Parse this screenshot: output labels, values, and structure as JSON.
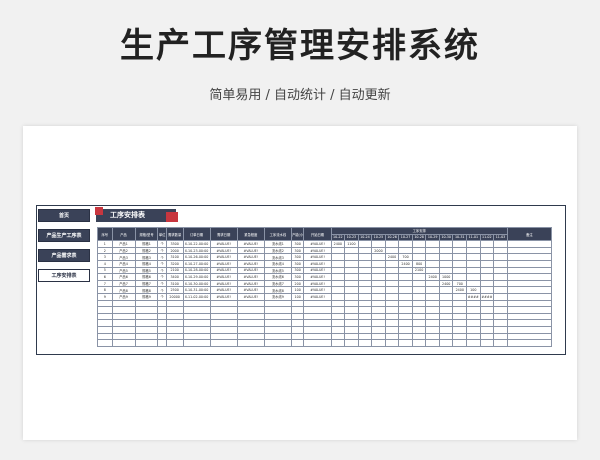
{
  "banner": {
    "title": "生产工序管理安排系统",
    "subtitle": "简单易用 / 自动统计 / 自动更新"
  },
  "sidebar": {
    "items": [
      {
        "label": "首页"
      },
      {
        "label": "产品生产工序表"
      },
      {
        "label": "产品需求表"
      },
      {
        "label": "工序安排表"
      }
    ]
  },
  "page": {
    "title": "工序安排表"
  },
  "table": {
    "headers": [
      "序号",
      "产品",
      "规格/型号",
      "单位",
      "需求数量",
      "订单日期",
      "需求日期",
      "紧急程度",
      "工序流水线",
      "产能(小时)",
      "开始日期"
    ],
    "gantt_header": "工序安排",
    "dates": [
      "10-22",
      "10-23",
      "10-24",
      "10-25",
      "10-26",
      "10-27",
      "10-28",
      "10-29",
      "10-30",
      "10-31",
      "11-01",
      "11-02",
      "11-03"
    ],
    "last_header": "备注",
    "rows": [
      {
        "no": "1",
        "product": "产品1",
        "spec": "规格1",
        "unit": "个",
        "qty": "3300",
        "order": "X-10-22-00:00",
        "need": "#VALUE!",
        "urgency": "#VALUE!",
        "line": "流水线1",
        "cap": "300",
        "start": "#VALUE!",
        "gantt": [
          "2400",
          "1100",
          "",
          "",
          "",
          "",
          "",
          "",
          "",
          "",
          "",
          "",
          ""
        ]
      },
      {
        "no": "2",
        "product": "产品2",
        "spec": "规格2",
        "unit": "个",
        "qty": "2000",
        "order": "X-10-23-00:00",
        "need": "#VALUE!",
        "urgency": "#VALUE!",
        "line": "流水线2",
        "cap": "300",
        "start": "#VALUE!",
        "gantt": [
          "",
          "",
          "",
          "2000",
          "",
          "",
          "",
          "",
          "",
          "",
          "",
          "",
          ""
        ]
      },
      {
        "no": "3",
        "product": "产品3",
        "spec": "规格3",
        "unit": "个",
        "qty": "3100",
        "order": "X-10-26-00:00",
        "need": "#VALUE!",
        "urgency": "#VALUE!",
        "line": "流水线3",
        "cap": "300",
        "start": "#VALUE!",
        "gantt": [
          "",
          "",
          "",
          "",
          "2400",
          "700",
          "",
          "",
          "",
          "",
          "",
          "",
          ""
        ]
      },
      {
        "no": "4",
        "product": "产品4",
        "spec": "规格4",
        "unit": "个",
        "qty": "3200",
        "order": "X-10-27-00:00",
        "need": "#VALUE!",
        "urgency": "#VALUE!",
        "line": "流水线4",
        "cap": "300",
        "start": "#VALUE!",
        "gantt": [
          "",
          "",
          "",
          "",
          "",
          "2400",
          "800",
          "",
          "",
          "",
          "",
          "",
          ""
        ]
      },
      {
        "no": "5",
        "product": "产品5",
        "spec": "规格5",
        "unit": "个",
        "qty": "2100",
        "order": "X-10-28-00:00",
        "need": "#VALUE!",
        "urgency": "#VALUE!",
        "line": "流水线5",
        "cap": "300",
        "start": "#VALUE!",
        "gantt": [
          "",
          "",
          "",
          "",
          "",
          "",
          "2100",
          "",
          "",
          "",
          "",
          "",
          ""
        ]
      },
      {
        "no": "6",
        "product": "产品6",
        "spec": "规格6",
        "unit": "个",
        "qty": "3400",
        "order": "X-10-29-00:00",
        "need": "#VALUE!",
        "urgency": "#VALUE!",
        "line": "流水线6",
        "cap": "300",
        "start": "#VALUE!",
        "gantt": [
          "",
          "",
          "",
          "",
          "",
          "",
          "",
          "2400",
          "1000",
          "",
          "",
          "",
          ""
        ]
      },
      {
        "no": "7",
        "product": "产品7",
        "spec": "规格7",
        "unit": "个",
        "qty": "3100",
        "order": "X-10-30-00:00",
        "need": "#VALUE!",
        "urgency": "#VALUE!",
        "line": "流水线7",
        "cap": "200",
        "start": "#VALUE!",
        "gantt": [
          "",
          "",
          "",
          "",
          "",
          "",
          "",
          "",
          "2400",
          "700",
          "",
          "",
          ""
        ]
      },
      {
        "no": "8",
        "product": "产品8",
        "spec": "规格8",
        "unit": "个",
        "qty": "2500",
        "order": "X-10-31-00:00",
        "need": "#VALUE!",
        "urgency": "#VALUE!",
        "line": "流水线8",
        "cap": "100",
        "start": "#VALUE!",
        "gantt": [
          "",
          "",
          "",
          "",
          "",
          "",
          "",
          "",
          "",
          "2400",
          "100",
          "",
          ""
        ]
      },
      {
        "no": "9",
        "product": "产品9",
        "spec": "规格9",
        "unit": "个",
        "qty": "20000",
        "order": "X-11-02-00:00",
        "need": "#VALUE!",
        "urgency": "#VALUE!",
        "line": "流水线9",
        "cap": "100",
        "start": "#VALUE!",
        "gantt": [
          "",
          "",
          "",
          "",
          "",
          "",
          "",
          "",
          "",
          "",
          "####",
          "####",
          ""
        ]
      }
    ],
    "empty_rows": 7
  }
}
